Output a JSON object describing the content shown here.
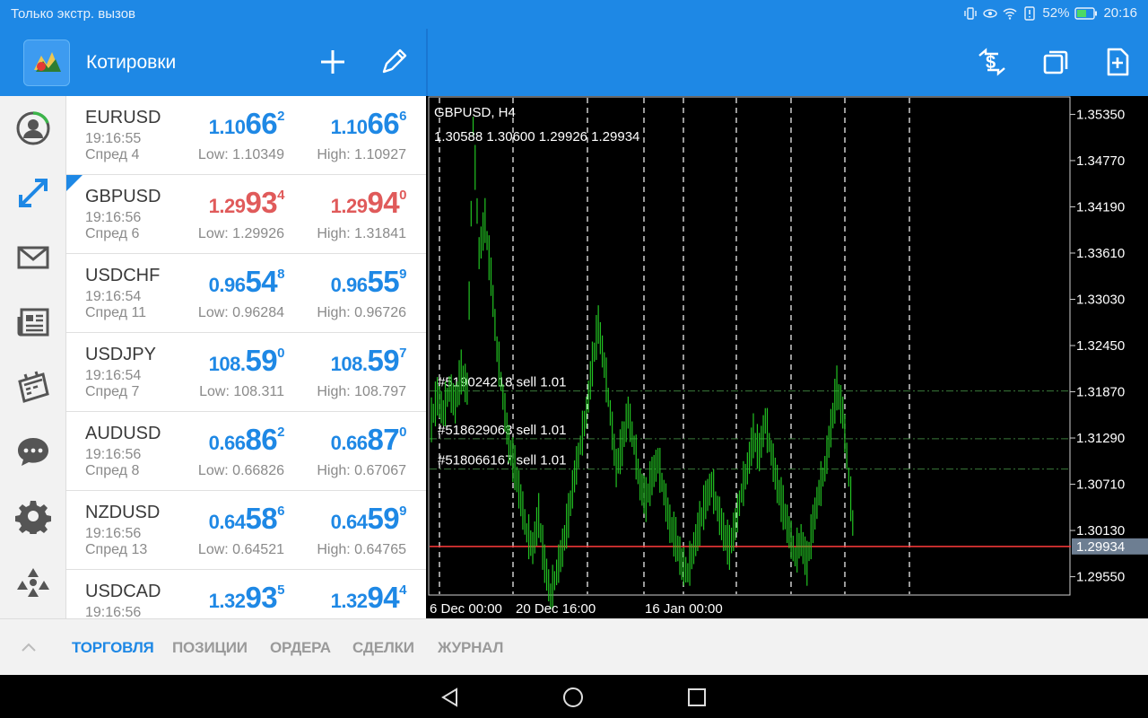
{
  "status_bar": {
    "left_text": "Только экстр. вызов",
    "battery": "52%",
    "time": "20:16"
  },
  "header": {
    "title": "Котировки",
    "icons": [
      "add-icon",
      "edit-icon",
      "currency-exchange-icon",
      "windows-icon",
      "new-document-icon"
    ]
  },
  "sidebar": {
    "items": [
      "account-icon",
      "trade-arrows-icon",
      "mail-icon",
      "news-icon",
      "calendar-icon",
      "chat-icon",
      "settings-icon",
      "community-icon"
    ]
  },
  "quotes": [
    {
      "symbol": "EURUSD",
      "time": "19:16:55",
      "spread": "Спред 4",
      "color": "blue",
      "bid": {
        "small": "1.10",
        "big": "66",
        "sup": "2"
      },
      "ask": {
        "small": "1.10",
        "big": "66",
        "sup": "6"
      },
      "low": "Low: 1.10349",
      "high": "High: 1.10927"
    },
    {
      "symbol": "GBPUSD",
      "time": "19:16:56",
      "spread": "Спред 6",
      "color": "red",
      "selected": true,
      "bid": {
        "small": "1.29",
        "big": "93",
        "sup": "4"
      },
      "ask": {
        "small": "1.29",
        "big": "94",
        "sup": "0"
      },
      "low": "Low: 1.29926",
      "high": "High: 1.31841"
    },
    {
      "symbol": "USDCHF",
      "time": "19:16:54",
      "spread": "Спред 11",
      "color": "blue",
      "bid": {
        "small": "0.96",
        "big": "54",
        "sup": "8"
      },
      "ask": {
        "small": "0.96",
        "big": "55",
        "sup": "9"
      },
      "low": "Low: 0.96284",
      "high": "High: 0.96726"
    },
    {
      "symbol": "USDJPY",
      "time": "19:16:54",
      "spread": "Спред 7",
      "color": "blue",
      "bid": {
        "small": "108.",
        "big": "59",
        "sup": "0"
      },
      "ask": {
        "small": "108.",
        "big": "59",
        "sup": "7"
      },
      "low": "Low: 108.311",
      "high": "High: 108.797"
    },
    {
      "symbol": "AUDUSD",
      "time": "19:16:56",
      "spread": "Спред 8",
      "color": "blue",
      "bid": {
        "small": "0.66",
        "big": "86",
        "sup": "2"
      },
      "ask": {
        "small": "0.66",
        "big": "87",
        "sup": "0"
      },
      "low": "Low: 0.66826",
      "high": "High: 0.67067"
    },
    {
      "symbol": "NZDUSD",
      "time": "19:16:56",
      "spread": "Спред 13",
      "color": "blue",
      "bid": {
        "small": "0.64",
        "big": "58",
        "sup": "6"
      },
      "ask": {
        "small": "0.64",
        "big": "59",
        "sup": "9"
      },
      "low": "Low: 0.64521",
      "high": "High: 0.64765"
    },
    {
      "symbol": "USDCAD",
      "time": "19:16:56",
      "spread": "",
      "color": "blue",
      "bid": {
        "small": "1.32",
        "big": "93",
        "sup": "5"
      },
      "ask": {
        "small": "1.32",
        "big": "94",
        "sup": "4"
      },
      "low": "",
      "high": ""
    }
  ],
  "chart": {
    "title": "GBPUSD, H4",
    "ohlc": "1.30588 1.30600 1.29926 1.29934",
    "current_price": "1.29934",
    "price_labels": [
      "1.35350",
      "1.34770",
      "1.34190",
      "1.33610",
      "1.33030",
      "1.32450",
      "1.31870",
      "1.31290",
      "1.30710",
      "1.30130",
      "1.29550"
    ],
    "date_labels": [
      "6 Dec 00:00",
      "20 Dec 16:00",
      "16 Jan 00:00"
    ],
    "orders": [
      {
        "label": "#519024218 sell 1.01",
        "price": 1.3188
      },
      {
        "label": "#518629063 sell 1.01",
        "price": 1.3128
      },
      {
        "label": "#518066167 sell 1.01",
        "price": 1.309
      }
    ],
    "colors": {
      "candle": "#22c322",
      "price_line": "#ff3b3b",
      "grid": "#ffffff",
      "order_line": "#3a7a3a"
    }
  },
  "chart_data": {
    "type": "line",
    "title": "GBPUSD, H4",
    "x": [
      "6 Dec 00:00",
      "20 Dec 16:00",
      "16 Jan 00:00"
    ],
    "ylim": [
      1.2932,
      1.3558
    ],
    "y_ticks": [
      1.3535,
      1.3477,
      1.3419,
      1.3361,
      1.3303,
      1.3245,
      1.3187,
      1.3129,
      1.3071,
      1.3013,
      1.2955
    ],
    "series": [
      {
        "values": [
          1.315,
          1.318,
          1.316,
          1.319,
          1.317,
          1.321,
          1.319,
          1.352,
          1.336,
          1.34,
          1.333,
          1.324,
          1.318,
          1.312,
          1.309,
          1.305,
          1.301,
          1.299,
          1.303,
          1.297,
          1.293,
          1.296,
          1.299,
          1.303,
          1.308,
          1.312,
          1.316,
          1.322,
          1.327,
          1.322,
          1.316,
          1.309,
          1.312,
          1.316,
          1.312,
          1.307,
          1.305,
          1.308,
          1.31,
          1.306,
          1.302,
          1.3,
          1.297,
          1.296,
          1.299,
          1.302,
          1.305,
          1.307,
          1.304,
          1.301,
          1.299,
          1.302,
          1.306,
          1.309,
          1.313,
          1.311,
          1.315,
          1.311,
          1.307,
          1.304,
          1.301,
          1.298,
          1.3,
          1.297,
          1.302,
          1.306,
          1.309,
          1.314,
          1.319,
          1.316,
          1.308,
          1.2993
        ]
      }
    ]
  },
  "tabs": [
    {
      "label": "ТОРГОВЛЯ",
      "active": true
    },
    {
      "label": "ПОЗИЦИИ"
    },
    {
      "label": "ОРДЕРА"
    },
    {
      "label": "СДЕЛКИ"
    },
    {
      "label": "ЖУРНАЛ"
    }
  ]
}
